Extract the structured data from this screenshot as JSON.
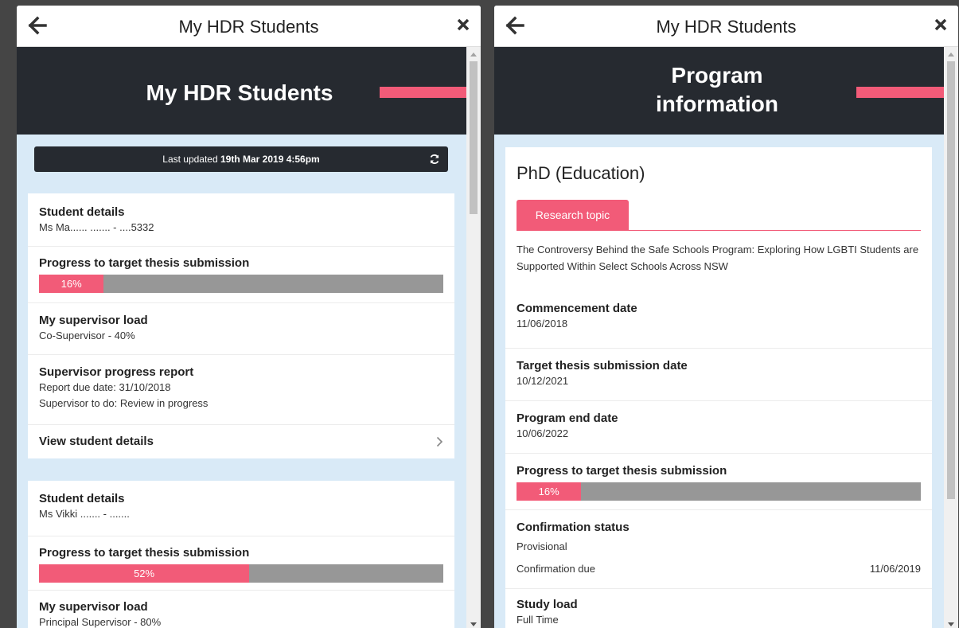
{
  "colors": {
    "accent": "#f25b78",
    "banner": "#262a30",
    "progress_track": "#979797",
    "background": "#d9eaf7"
  },
  "left": {
    "window_title": "My HDR Students",
    "banner_title": "My HDR Students",
    "last_updated_prefix": "Last updated ",
    "last_updated_time": "19th Mar 2019 4:56pm",
    "students": [
      {
        "student_details_label": "Student details",
        "student_details_value": "Ms Ma...... .......  - ....5332",
        "progress_label": "Progress to target thesis submission",
        "progress_text": "16%",
        "progress_fraction": 0.16,
        "load_label": "My supervisor load",
        "load_value": "Co-Supervisor - 40%",
        "report_label": "Supervisor progress report",
        "report_due": "Report due date: 31/10/2018",
        "report_todo": "Supervisor to do: Review in progress",
        "view_link": "View student details"
      },
      {
        "student_details_label": "Student details",
        "student_details_value": "Ms Vikki ....... - .......",
        "progress_label": "Progress to target thesis submission",
        "progress_text": "52%",
        "progress_fraction": 0.52,
        "load_label": "My supervisor load",
        "load_value": "Principal Supervisor - 80%"
      }
    ]
  },
  "right": {
    "window_title": "My HDR Students",
    "banner_title_line1": "Program",
    "banner_title_line2": "information",
    "program_name": "PhD (Education)",
    "tab_label": "Research topic",
    "research_topic": "The Controversy Behind the Safe Schools Program: Exploring How LGBTI Students are Supported Within Select Schools Across NSW",
    "commencement_label": "Commencement date",
    "commencement_value": "11/06/2018",
    "target_label": "Target thesis submission date",
    "target_value": "10/12/2021",
    "end_label": "Program end date",
    "end_value": "10/06/2022",
    "progress_label": "Progress to target thesis submission",
    "progress_text": "16%",
    "progress_fraction": 0.16,
    "confirmation_label": "Confirmation status",
    "confirmation_value": "Provisional",
    "confirmation_due_label": "Confirmation due",
    "confirmation_due_value": "11/06/2019",
    "study_load_label": "Study load",
    "study_load_value": "Full Time"
  },
  "icons": {
    "back": "arrow-left-icon",
    "close": "close-x-icon",
    "refresh": "refresh-icon",
    "chevron": "chevron-right-icon"
  }
}
